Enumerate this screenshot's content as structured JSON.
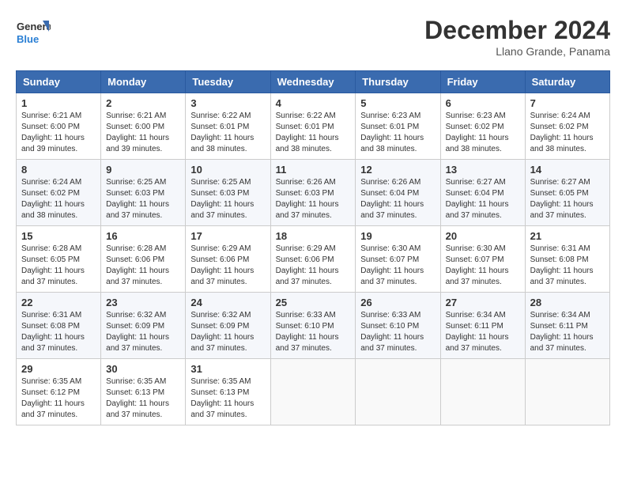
{
  "header": {
    "logo_line1": "General",
    "logo_line2": "Blue",
    "month": "December 2024",
    "location": "Llano Grande, Panama"
  },
  "weekdays": [
    "Sunday",
    "Monday",
    "Tuesday",
    "Wednesday",
    "Thursday",
    "Friday",
    "Saturday"
  ],
  "weeks": [
    [
      {
        "day": "1",
        "info": "Sunrise: 6:21 AM\nSunset: 6:00 PM\nDaylight: 11 hours and 39 minutes."
      },
      {
        "day": "2",
        "info": "Sunrise: 6:21 AM\nSunset: 6:00 PM\nDaylight: 11 hours and 39 minutes."
      },
      {
        "day": "3",
        "info": "Sunrise: 6:22 AM\nSunset: 6:01 PM\nDaylight: 11 hours and 38 minutes."
      },
      {
        "day": "4",
        "info": "Sunrise: 6:22 AM\nSunset: 6:01 PM\nDaylight: 11 hours and 38 minutes."
      },
      {
        "day": "5",
        "info": "Sunrise: 6:23 AM\nSunset: 6:01 PM\nDaylight: 11 hours and 38 minutes."
      },
      {
        "day": "6",
        "info": "Sunrise: 6:23 AM\nSunset: 6:02 PM\nDaylight: 11 hours and 38 minutes."
      },
      {
        "day": "7",
        "info": "Sunrise: 6:24 AM\nSunset: 6:02 PM\nDaylight: 11 hours and 38 minutes."
      }
    ],
    [
      {
        "day": "8",
        "info": "Sunrise: 6:24 AM\nSunset: 6:02 PM\nDaylight: 11 hours and 38 minutes."
      },
      {
        "day": "9",
        "info": "Sunrise: 6:25 AM\nSunset: 6:03 PM\nDaylight: 11 hours and 37 minutes."
      },
      {
        "day": "10",
        "info": "Sunrise: 6:25 AM\nSunset: 6:03 PM\nDaylight: 11 hours and 37 minutes."
      },
      {
        "day": "11",
        "info": "Sunrise: 6:26 AM\nSunset: 6:03 PM\nDaylight: 11 hours and 37 minutes."
      },
      {
        "day": "12",
        "info": "Sunrise: 6:26 AM\nSunset: 6:04 PM\nDaylight: 11 hours and 37 minutes."
      },
      {
        "day": "13",
        "info": "Sunrise: 6:27 AM\nSunset: 6:04 PM\nDaylight: 11 hours and 37 minutes."
      },
      {
        "day": "14",
        "info": "Sunrise: 6:27 AM\nSunset: 6:05 PM\nDaylight: 11 hours and 37 minutes."
      }
    ],
    [
      {
        "day": "15",
        "info": "Sunrise: 6:28 AM\nSunset: 6:05 PM\nDaylight: 11 hours and 37 minutes."
      },
      {
        "day": "16",
        "info": "Sunrise: 6:28 AM\nSunset: 6:06 PM\nDaylight: 11 hours and 37 minutes."
      },
      {
        "day": "17",
        "info": "Sunrise: 6:29 AM\nSunset: 6:06 PM\nDaylight: 11 hours and 37 minutes."
      },
      {
        "day": "18",
        "info": "Sunrise: 6:29 AM\nSunset: 6:06 PM\nDaylight: 11 hours and 37 minutes."
      },
      {
        "day": "19",
        "info": "Sunrise: 6:30 AM\nSunset: 6:07 PM\nDaylight: 11 hours and 37 minutes."
      },
      {
        "day": "20",
        "info": "Sunrise: 6:30 AM\nSunset: 6:07 PM\nDaylight: 11 hours and 37 minutes."
      },
      {
        "day": "21",
        "info": "Sunrise: 6:31 AM\nSunset: 6:08 PM\nDaylight: 11 hours and 37 minutes."
      }
    ],
    [
      {
        "day": "22",
        "info": "Sunrise: 6:31 AM\nSunset: 6:08 PM\nDaylight: 11 hours and 37 minutes."
      },
      {
        "day": "23",
        "info": "Sunrise: 6:32 AM\nSunset: 6:09 PM\nDaylight: 11 hours and 37 minutes."
      },
      {
        "day": "24",
        "info": "Sunrise: 6:32 AM\nSunset: 6:09 PM\nDaylight: 11 hours and 37 minutes."
      },
      {
        "day": "25",
        "info": "Sunrise: 6:33 AM\nSunset: 6:10 PM\nDaylight: 11 hours and 37 minutes."
      },
      {
        "day": "26",
        "info": "Sunrise: 6:33 AM\nSunset: 6:10 PM\nDaylight: 11 hours and 37 minutes."
      },
      {
        "day": "27",
        "info": "Sunrise: 6:34 AM\nSunset: 6:11 PM\nDaylight: 11 hours and 37 minutes."
      },
      {
        "day": "28",
        "info": "Sunrise: 6:34 AM\nSunset: 6:11 PM\nDaylight: 11 hours and 37 minutes."
      }
    ],
    [
      {
        "day": "29",
        "info": "Sunrise: 6:35 AM\nSunset: 6:12 PM\nDaylight: 11 hours and 37 minutes."
      },
      {
        "day": "30",
        "info": "Sunrise: 6:35 AM\nSunset: 6:13 PM\nDaylight: 11 hours and 37 minutes."
      },
      {
        "day": "31",
        "info": "Sunrise: 6:35 AM\nSunset: 6:13 PM\nDaylight: 11 hours and 37 minutes."
      },
      null,
      null,
      null,
      null
    ]
  ]
}
